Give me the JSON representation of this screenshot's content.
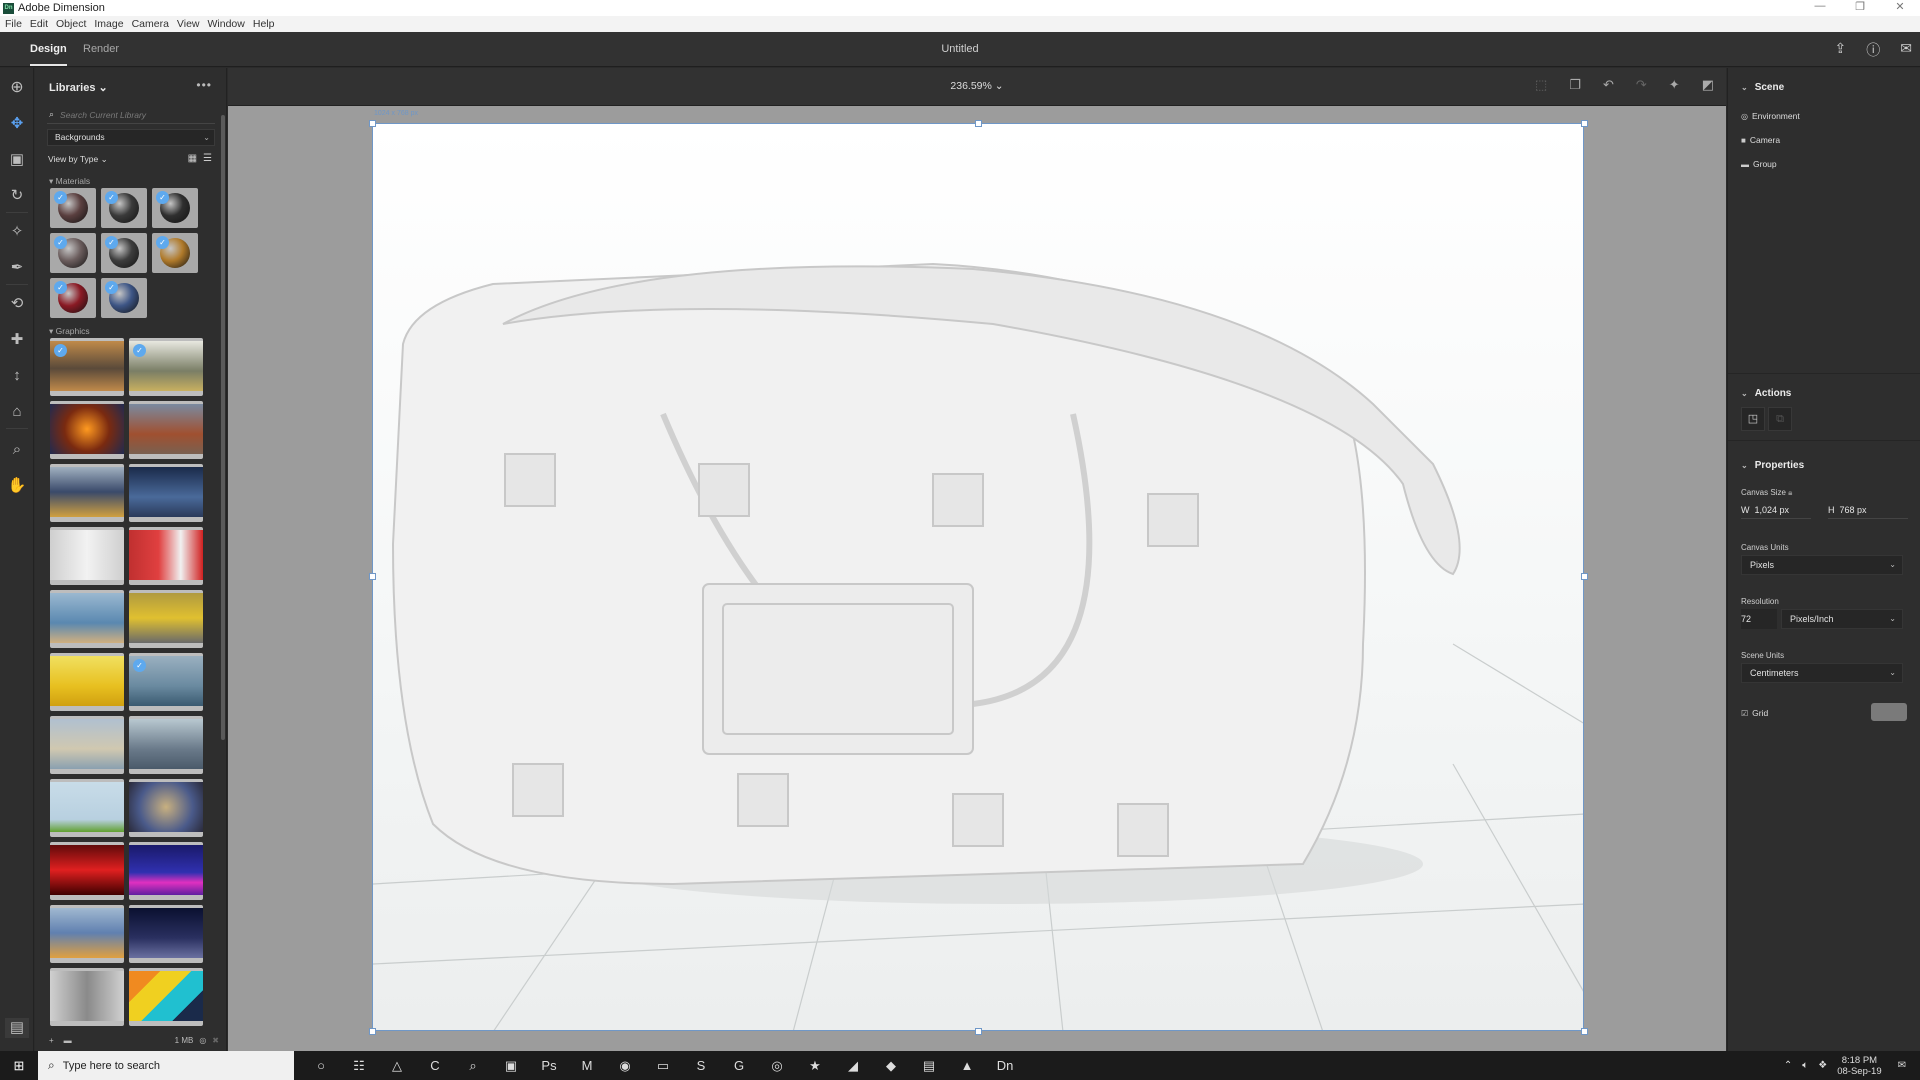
{
  "window": {
    "app_title": "Adobe Dimension",
    "app_icon": "Dn",
    "controls": {
      "minimize": "—",
      "maximize": "❐",
      "close": "✕"
    }
  },
  "menu": [
    "File",
    "Edit",
    "Object",
    "Image",
    "Camera",
    "View",
    "Window",
    "Help"
  ],
  "appbar": {
    "tabs": [
      {
        "label": "Design",
        "active": true
      },
      {
        "label": "Render",
        "active": false
      }
    ],
    "document_title": "Untitled",
    "right_icons": [
      "share-icon",
      "help-icon",
      "feedback-icon"
    ]
  },
  "tools": [
    {
      "name": "select-tool",
      "glyph": "✥",
      "selected": true
    },
    {
      "name": "selection-box-tool",
      "glyph": "▣"
    },
    {
      "name": "orbit-tool",
      "glyph": "↻"
    },
    {
      "name": "magic-wand-tool",
      "glyph": "✧"
    },
    {
      "name": "sample-tool",
      "glyph": "✒"
    },
    {
      "name": "orbit-camera-tool",
      "glyph": "⟲"
    },
    {
      "name": "pan-camera-tool",
      "glyph": "✚"
    },
    {
      "name": "dolly-camera-tool",
      "glyph": "↕"
    },
    {
      "name": "horizon-tool",
      "glyph": "⌂"
    },
    {
      "name": "zoom-tool",
      "glyph": "⌕"
    },
    {
      "name": "hand-tool",
      "glyph": "✋"
    }
  ],
  "library": {
    "title": "Libraries",
    "more": "•••",
    "search_placeholder": "Search Current Library",
    "selected_library": "Backgrounds",
    "view_by": "View by Type",
    "sections": {
      "materials": "Materials",
      "graphics": "Graphics"
    },
    "materials": [
      {
        "color": "#5a3f3f",
        "checked": true
      },
      {
        "color": "#3a3a3a",
        "checked": true
      },
      {
        "color": "#2f2f2f",
        "checked": true
      },
      {
        "color": "#6b5d5d",
        "checked": true
      },
      {
        "color": "#3d3d3d",
        "checked": true
      },
      {
        "color": "#b07a2a",
        "checked": true
      },
      {
        "color": "#8a1a24",
        "checked": true
      },
      {
        "color": "#3d5585",
        "checked": true
      }
    ],
    "graphics": [
      {
        "gradient": "linear-gradient(180deg,#c08a4a,#5a4a3a 55%,#c08a4a)",
        "checked": true
      },
      {
        "gradient": "linear-gradient(180deg,#e8e8e0,#7a7e66 60%,#c8b060)",
        "checked": true
      },
      {
        "gradient": "radial-gradient(circle,#ff9a20,#7a2a10 50%,#202a50)",
        "checked": false
      },
      {
        "gradient": "linear-gradient(180deg,#7a8aa0,#a05030 60%,#7a6050)",
        "checked": false
      },
      {
        "gradient": "linear-gradient(180deg,#a0b0c0,#3a4a6a 50%,#d0a040)",
        "checked": false
      },
      {
        "gradient": "linear-gradient(180deg,#1a2a4a,#4a6a9a 60%,#2a3a5a)",
        "checked": false
      },
      {
        "gradient": "linear-gradient(90deg,#cfcfcf,#f2f2f2 50%,#cfcfcf)",
        "checked": false
      },
      {
        "gradient": "linear-gradient(90deg,#c03030,#e04040 40%,#f0f0f0 70%,#d02020)",
        "checked": false
      },
      {
        "gradient": "linear-gradient(180deg,#9ab8d0,#5a88b0 60%,#d0b080)",
        "checked": false
      },
      {
        "gradient": "linear-gradient(180deg,#b09a40,#e0c030 50%,#6a6a6a)",
        "checked": false
      },
      {
        "gradient": "linear-gradient(180deg,#f0e060,#e8c020 60%,#d0a010)",
        "checked": false
      },
      {
        "gradient": "linear-gradient(180deg,#9ab0c0,#6a8aa0 60%,#3a5a70)",
        "checked": true
      },
      {
        "gradient": "linear-gradient(180deg,#b0c0d0,#d0c8b0 60%,#8aa0b0)",
        "checked": false
      },
      {
        "gradient": "linear-gradient(180deg,#b8c8d0,#6a7a8a 60%,#4a5a6a)",
        "checked": false
      },
      {
        "gradient": "linear-gradient(180deg,#c8dce8,#b8d0e0 75%,#60a030)",
        "checked": false
      },
      {
        "gradient": "radial-gradient(circle,#c8b080,#4a5a8a 60%,#2a2a3a)",
        "checked": false
      },
      {
        "gradient": "linear-gradient(180deg,#600a0a,#e02020 50%,#400000)",
        "checked": false
      },
      {
        "gradient": "linear-gradient(180deg,#1a1a6a,#3030b0 55%,#e030c0 75%,#6020a0)",
        "checked": false
      },
      {
        "gradient": "linear-gradient(180deg,#a0b8d0,#6080b0 50%,#e0a040)",
        "checked": false
      },
      {
        "gradient": "linear-gradient(180deg,#0a1030,#2a3060 60%,#6a70a0)",
        "checked": false
      },
      {
        "gradient": "linear-gradient(90deg,#d0d0d0,#8a8a8a 50%,#d0d0d0)",
        "checked": false
      },
      {
        "gradient": "linear-gradient(135deg,#f08a20 25%,#f0d020 25%,#f0d020 50%,#20c0d0 50%,#20c0d0 75%,#1a2a4a 75%)",
        "checked": false
      }
    ],
    "footer": {
      "size": "1 MB"
    }
  },
  "viewport": {
    "zoom_level": "236.59%",
    "canvas_size_tag": "1024 x 768 px"
  },
  "scene": {
    "title": "Scene",
    "items": [
      {
        "label": "Environment",
        "icon": "◎"
      },
      {
        "label": "Camera",
        "icon": "■"
      },
      {
        "label": "Group",
        "icon": "▬"
      }
    ]
  },
  "actions": {
    "title": "Actions"
  },
  "properties": {
    "title": "Properties",
    "canvas_size_label": "Canvas Size",
    "width_label": "W",
    "width_value": "1,024 px",
    "height_label": "H",
    "height_value": "768 px",
    "canvas_units_label": "Canvas Units",
    "canvas_units_value": "Pixels",
    "resolution_label": "Resolution",
    "resolution_value": "72",
    "resolution_unit": "Pixels/Inch",
    "scene_units_label": "Scene Units",
    "scene_units_value": "Centimeters",
    "grid_label": "Grid",
    "grid_checked": true
  },
  "taskbar": {
    "search_placeholder": "Type here to search",
    "time": "8:18 PM",
    "date": "08-Sep-19",
    "apps": [
      "○",
      "☷",
      "△",
      "C",
      "⌕",
      "▣",
      "Ps",
      "M",
      "◉",
      "▭",
      "S",
      "G",
      "◎",
      "★",
      "◢",
      "◆",
      "▤",
      "▲",
      "Dn"
    ]
  }
}
